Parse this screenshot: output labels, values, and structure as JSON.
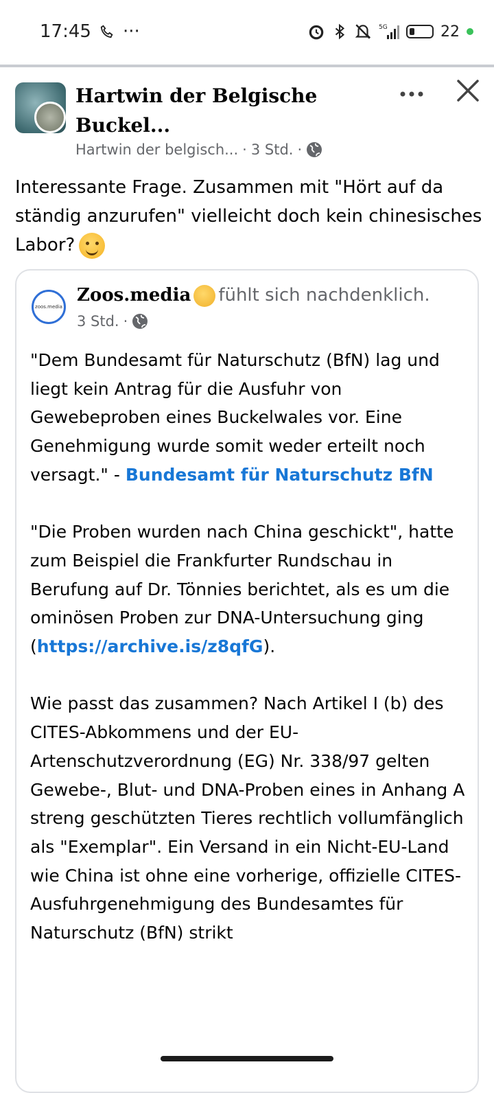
{
  "status_bar": {
    "time": "17:45",
    "dots": "···",
    "network": "5G",
    "battery_percent": "22"
  },
  "post": {
    "author_name": "Hartwin der Belgische Buckel...",
    "meta_name": "Hartwin der belgisch...",
    "time": "3 Std.",
    "text": "Interessante Frage. Zusammen mit \"Hört auf da ständig anzurufen\" vielleicht doch kein chinesisches Labor?",
    "avatar_badge_text": ""
  },
  "shared": {
    "avatar_text": "zoos.media",
    "author": "Zoos.media",
    "feeling": "fühlt sich nachdenklich.",
    "time": "3 Std.",
    "p1_text": "\"Dem Bundesamt für Naturschutz (BfN) lag und liegt kein Antrag für die Ausfuhr von Gewebeproben eines Buckelwales vor. Eine Genehmigung wurde somit weder erteilt noch versagt.\" - ",
    "p1_link": "Bundesamt für Naturschutz BfN",
    "p2_text": "\"Die Proben wurden nach China geschickt\", hatte zum Beispiel die Frankfurter Rundschau in Berufung auf Dr. Tönnies berichtet, als es um die ominösen Proben zur DNA-Untersuchung ging (",
    "p2_link": "https://archive.is/z8qfG",
    "p2_end": ").",
    "p3_text": "Wie passt das zusammen? Nach Artikel I (b) des CITES-Abkommens und der EU-Artenschutzverordnung (EG) Nr. 338/97 gelten Gewebe-, Blut- und DNA-Proben eines in Anhang A streng geschützten Tieres rechtlich vollumfänglich als \"Exemplar\". Ein Versand in ein Nicht-EU-Land wie China ist ohne eine vorherige, offizielle CITES-Ausfuhrgenehmigung des Bundesamtes für Naturschutz (BfN) strikt"
  },
  "icons": {
    "more": "more-options-icon",
    "close": "close-icon",
    "globe": "globe-icon"
  }
}
